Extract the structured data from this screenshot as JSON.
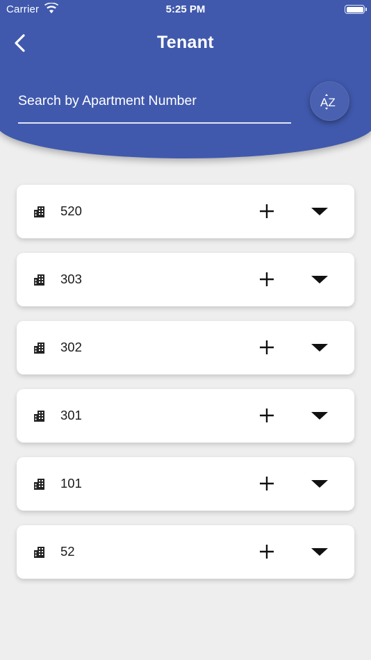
{
  "status_bar": {
    "carrier": "Carrier",
    "time": "5:25 PM",
    "wifi_icon": "wifi-icon",
    "battery_icon": "battery-icon",
    "battery_level": 1.0
  },
  "header": {
    "title": "Tenant",
    "back_icon": "chevron-left-icon",
    "background_color": "#4059ad"
  },
  "search": {
    "placeholder": "Search by Apartment Number",
    "value": "",
    "sort_icon": "sort-az-icon",
    "sort_icon_text": "AZ"
  },
  "apartments": [
    {
      "number": "520"
    },
    {
      "number": "303"
    },
    {
      "number": "302"
    },
    {
      "number": "301"
    },
    {
      "number": "101"
    },
    {
      "number": "52"
    }
  ],
  "row_icons": {
    "building": "building-icon",
    "add": "plus-icon",
    "expand": "caret-down-icon"
  }
}
